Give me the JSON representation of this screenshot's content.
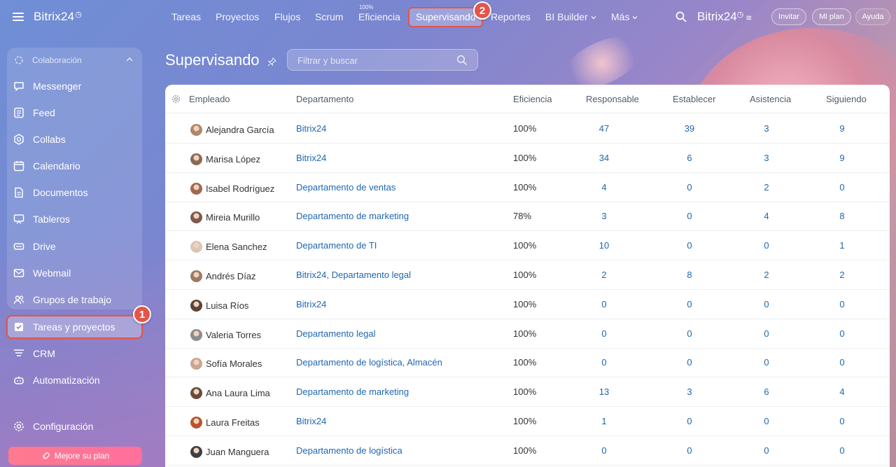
{
  "sidebar": {
    "brand": "Bitrix24",
    "group_label": "Colaboración",
    "items": [
      {
        "label": "Messenger",
        "icon": "chat-icon"
      },
      {
        "label": "Feed",
        "icon": "feed-icon"
      },
      {
        "label": "Collabs",
        "icon": "collabs-icon"
      },
      {
        "label": "Calendario",
        "icon": "calendar-icon"
      },
      {
        "label": "Documentos",
        "icon": "document-icon"
      },
      {
        "label": "Tableros",
        "icon": "board-icon"
      },
      {
        "label": "Drive",
        "icon": "drive-icon"
      },
      {
        "label": "Webmail",
        "icon": "mail-icon"
      },
      {
        "label": "Grupos de trabajo",
        "icon": "groups-icon"
      },
      {
        "label": "Tareas y proyectos",
        "icon": "checkbox-icon"
      },
      {
        "label": "CRM",
        "icon": "funnel-icon"
      },
      {
        "label": "Automatización",
        "icon": "robot-icon"
      },
      {
        "label": "Configuración",
        "icon": "gear-icon"
      }
    ],
    "upgrade_label": "Mejore su plan",
    "badge1": "1"
  },
  "topnav": {
    "items": [
      "Tareas",
      "Proyectos",
      "Flujos",
      "Scrum",
      "Eficiencia",
      "Supervisando",
      "Reportes",
      "BI Builder",
      "Más"
    ],
    "efficiency_small": "100%",
    "badge2": "2",
    "brand": "Bitrix24",
    "invite": "Invitar",
    "my_plan": "Mi plan",
    "help": "Ayuda"
  },
  "page": {
    "title": "Supervisando",
    "filter_placeholder": "Filtrar y buscar"
  },
  "table": {
    "headers": [
      "Empleado",
      "Departamento",
      "Eficiencia",
      "Responsable",
      "Establecer",
      "Asistencia",
      "Siguiendo"
    ],
    "rows": [
      {
        "name": "Alejandra García",
        "dept": "Bitrix24",
        "eff": "100%",
        "resp": "47",
        "est": "39",
        "asis": "3",
        "seg": "9",
        "av": "#b0876a"
      },
      {
        "name": "Marisa López",
        "dept": "Bitrix24",
        "eff": "100%",
        "resp": "34",
        "est": "6",
        "asis": "3",
        "seg": "9",
        "av": "#8a6a55"
      },
      {
        "name": "Isabel Rodríguez",
        "dept": "Departamento de ventas",
        "eff": "100%",
        "resp": "4",
        "est": "0",
        "asis": "2",
        "seg": "0",
        "av": "#a0684f"
      },
      {
        "name": "Mireia Murillo",
        "dept": "Departamento de marketing",
        "eff": "78%",
        "resp": "3",
        "est": "0",
        "asis": "4",
        "seg": "8",
        "av": "#7d5a4c"
      },
      {
        "name": "Elena Sanchez",
        "dept": "Departamento de TI",
        "eff": "100%",
        "resp": "10",
        "est": "0",
        "asis": "0",
        "seg": "1",
        "av": "#d8c7b8"
      },
      {
        "name": "Andrés Díaz",
        "dept": "Bitrix24, Departamento legal",
        "eff": "100%",
        "resp": "2",
        "est": "8",
        "asis": "2",
        "seg": "2",
        "av": "#9c7a66"
      },
      {
        "name": "Luisa Ríos",
        "dept": "Bitrix24",
        "eff": "100%",
        "resp": "0",
        "est": "0",
        "asis": "0",
        "seg": "0",
        "av": "#5a4436"
      },
      {
        "name": "Valeria Torres",
        "dept": "Departamento legal",
        "eff": "100%",
        "resp": "0",
        "est": "0",
        "asis": "0",
        "seg": "0",
        "av": "#8c8c8c"
      },
      {
        "name": "Sofía Morales",
        "dept": "Departamento de logística, Almacén",
        "eff": "100%",
        "resp": "0",
        "est": "0",
        "asis": "0",
        "seg": "0",
        "av": "#c9a48f"
      },
      {
        "name": "Ana Laura Lima",
        "dept": "Departamento de marketing",
        "eff": "100%",
        "resp": "13",
        "est": "3",
        "asis": "6",
        "seg": "4",
        "av": "#6b4a3a"
      },
      {
        "name": "Laura Freitas",
        "dept": "Bitrix24",
        "eff": "100%",
        "resp": "1",
        "est": "0",
        "asis": "0",
        "seg": "0",
        "av": "#b8552f"
      },
      {
        "name": "Juan Manguera",
        "dept": "Departamento de logística",
        "eff": "100%",
        "resp": "0",
        "est": "0",
        "asis": "0",
        "seg": "0",
        "av": "#3e3e46"
      }
    ]
  }
}
